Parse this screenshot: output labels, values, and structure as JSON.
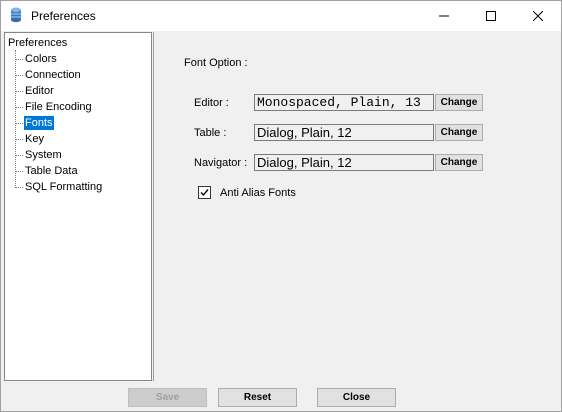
{
  "window": {
    "title": "Preferences"
  },
  "tree": {
    "root": "Preferences",
    "items": [
      {
        "label": "Colors"
      },
      {
        "label": "Connection"
      },
      {
        "label": "Editor"
      },
      {
        "label": "File Encoding"
      },
      {
        "label": "Fonts",
        "selected": true
      },
      {
        "label": "Key"
      },
      {
        "label": "System"
      },
      {
        "label": "Table Data"
      },
      {
        "label": "SQL Formatting"
      }
    ]
  },
  "fonts": {
    "section_title": "Font Option :",
    "editor": {
      "label": "Editor :",
      "value": "Monospaced, Plain, 13",
      "button": "Change"
    },
    "table": {
      "label": "Table :",
      "value": "Dialog, Plain, 12",
      "button": "Change"
    },
    "navigator": {
      "label": "Navigator :",
      "value": "Dialog, Plain, 12",
      "button": "Change"
    },
    "anti_alias": {
      "label": "Anti Alias Fonts",
      "checked": true
    }
  },
  "footer": {
    "save": "Save",
    "reset": "Reset",
    "close": "Close"
  },
  "colors": {
    "selection": "#0078d7",
    "panel_bg": "#f0f0f0"
  }
}
